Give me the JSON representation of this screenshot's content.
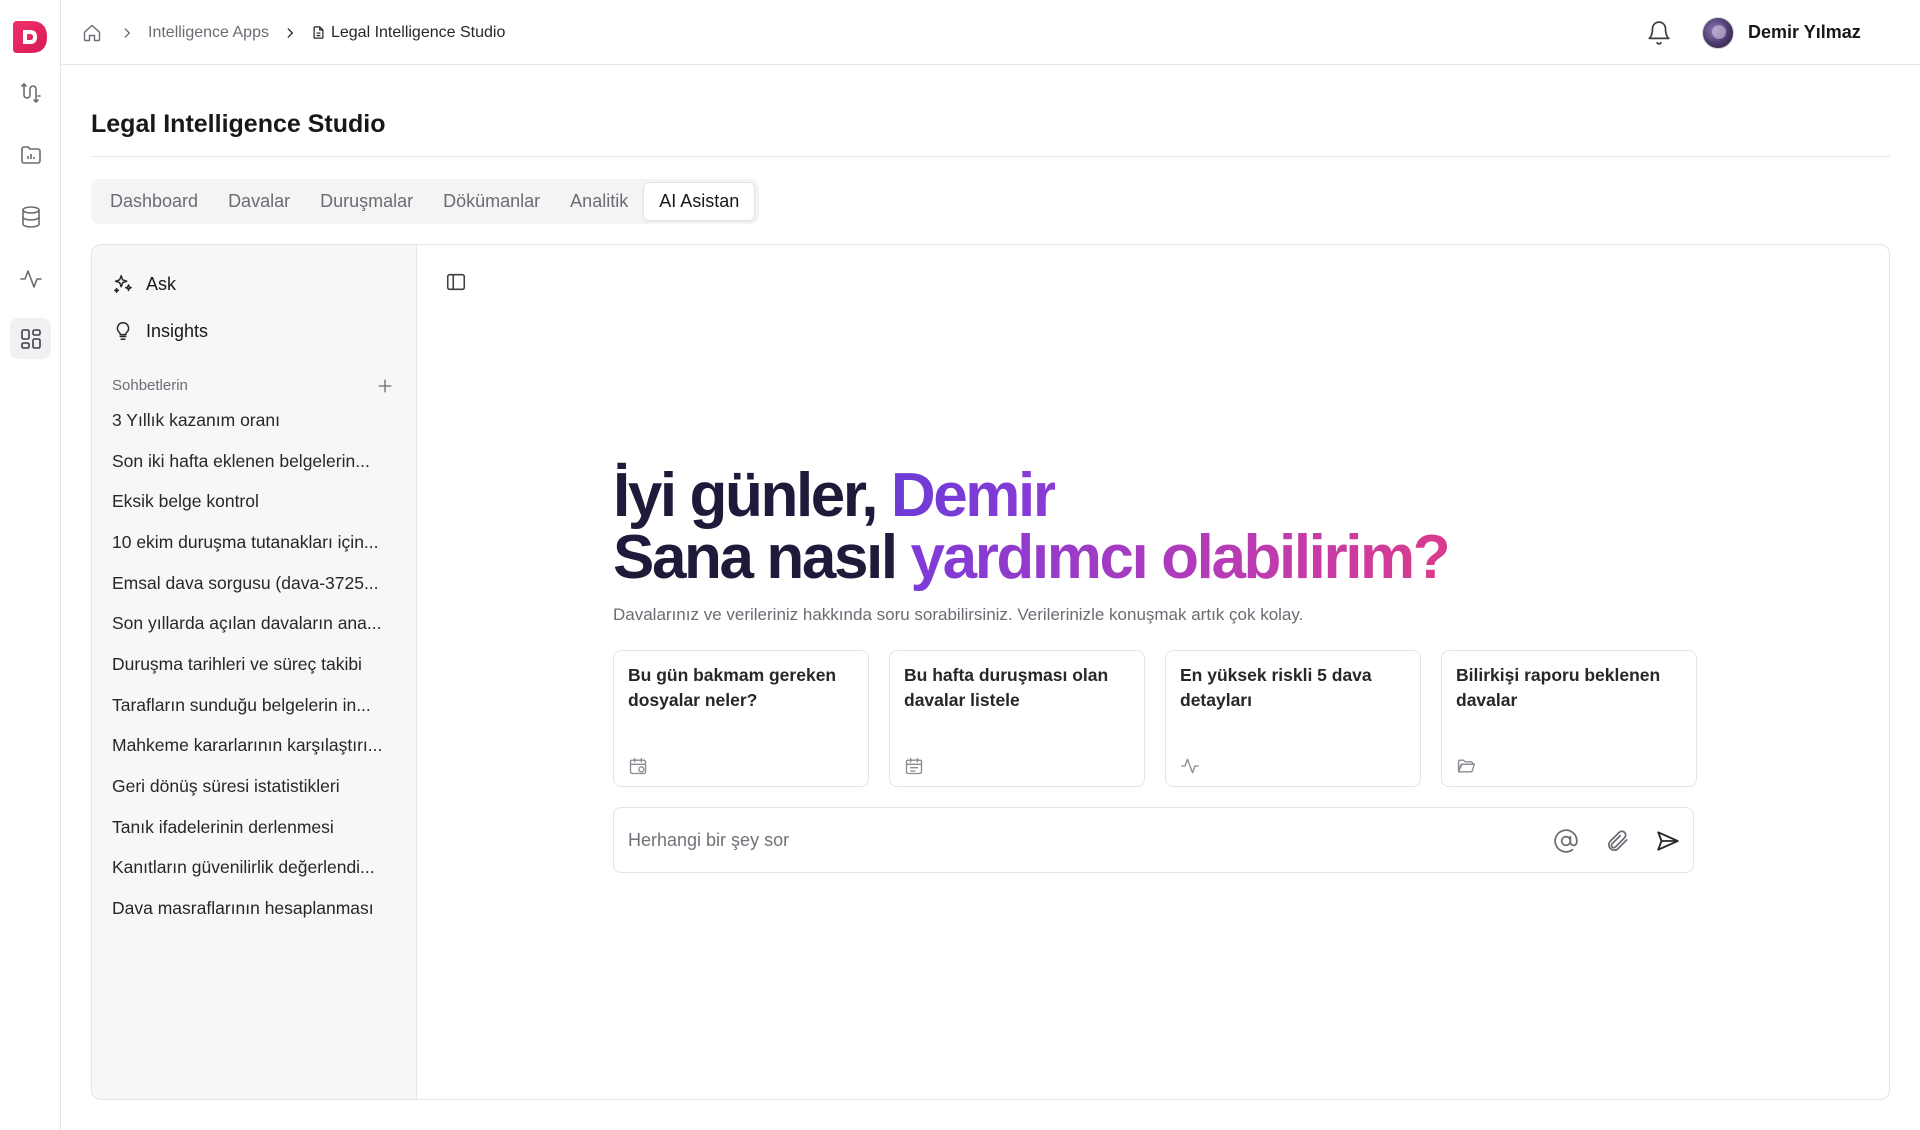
{
  "brand": {
    "logo_letter": "D",
    "accent": "#e11d5a"
  },
  "breadcrumb": {
    "home_icon": "home-icon",
    "items": [
      "Intelligence Apps",
      "Legal Intelligence Studio"
    ]
  },
  "user": {
    "name": "Demir Yılmaz"
  },
  "page": {
    "title": "Legal Intelligence Studio"
  },
  "tabs": [
    "Dashboard",
    "Davalar",
    "Duruşmalar",
    "Dökümanlar",
    "Analitik",
    "AI Asistan"
  ],
  "active_tab": "AI Asistan",
  "sidebar": {
    "nav": [
      {
        "label": "Ask",
        "icon": "sparkles-icon"
      },
      {
        "label": "Insights",
        "icon": "lightbulb-icon"
      }
    ],
    "section_title": "Sohbetlerin",
    "chats": [
      "3 Yıllık kazanım oranı",
      "Son iki hafta eklenen belgelerin...",
      "Eksik belge kontrol",
      "10 ekim duruşma tutanakları için...",
      "Emsal dava sorgusu (dava-3725...",
      "Son yıllarda açılan davaların ana...",
      "Duruşma tarihleri ve süreç takibi",
      "Tarafların sunduğu belgelerin in...",
      "Mahkeme kararlarının karşılaştırı...",
      "Geri dönüş süresi istatistikleri",
      "Tanık ifadelerinin derlenmesi",
      "Kanıtların güvenilirlik değerlendi...",
      "Dava masraflarının hesaplanması"
    ]
  },
  "hero": {
    "greeting": "İyi günler, ",
    "name": "Demir",
    "line2_a": "Sana nasıl ",
    "line2_b": "yardımcı olabilirim?",
    "subtitle": "Davalarınız ve verileriniz hakkında soru sorabilirsiniz. Verilerinizle konuşmak artık çok kolay.",
    "gradient": [
      "#7d3bd8",
      "#b43bb8",
      "#db3b8c"
    ]
  },
  "suggestions": [
    {
      "text": "Bu gün bakmam gereken dosyalar neler?",
      "icon": "calendar-clock-icon"
    },
    {
      "text": "Bu hafta duruşması olan davalar listele",
      "icon": "calendar-icon"
    },
    {
      "text": "En yüksek riskli 5 dava detayları",
      "icon": "activity-icon"
    },
    {
      "text": "Bilirkişi raporu beklenen davalar",
      "icon": "folder-open-icon"
    }
  ],
  "composer": {
    "placeholder": "Herhangi bir şey sor"
  }
}
